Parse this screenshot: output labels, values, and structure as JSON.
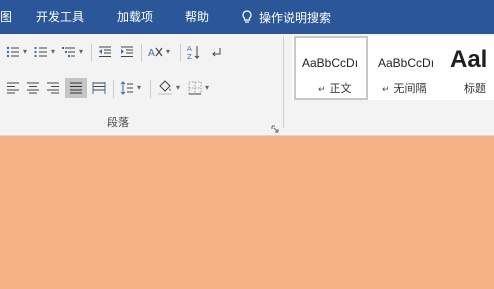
{
  "tabs": [
    {
      "label": "图"
    },
    {
      "label": "开发工具"
    },
    {
      "label": "加载项"
    },
    {
      "label": "帮助"
    }
  ],
  "tell_me": {
    "label": "操作说明搜索"
  },
  "ribbon": {
    "paragraph_group_label": "段落",
    "styles": [
      {
        "sample": "AaBbCcDı",
        "name": "正文",
        "return_mark": "↵"
      },
      {
        "sample": "AaBbCcDı",
        "name": "无间隔",
        "return_mark": "↵"
      },
      {
        "sample": "Aal",
        "name": "标题",
        "return_mark": ""
      }
    ]
  },
  "colors": {
    "titlebar": "#2b579a",
    "ribbon": "#f3f3f3",
    "document": "#f4b183"
  }
}
